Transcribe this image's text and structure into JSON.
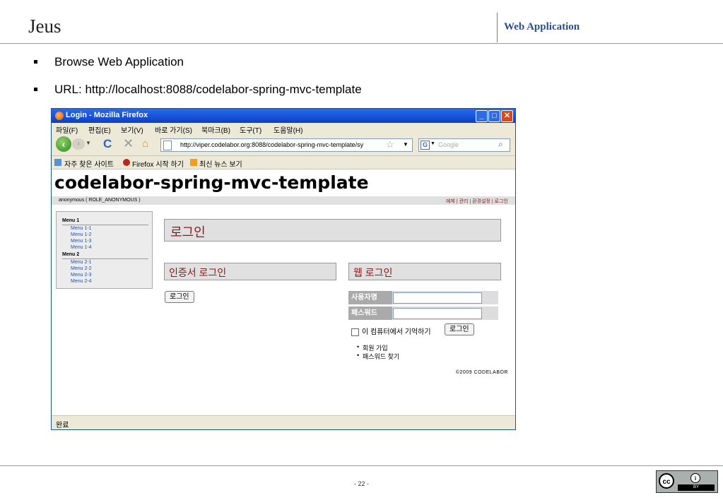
{
  "slide": {
    "title": "Jeus",
    "section": "Web Application",
    "bullets": [
      "Browse Web Application",
      "URL: http://localhost:8088/codelabor-spring-mvc-template"
    ],
    "page_number": "- 22 -"
  },
  "browser": {
    "window_title": "Login - Mozilla Firefox",
    "menu": [
      "파일(F)",
      "편집(E)",
      "보기(V)",
      "바로 가기(S)",
      "북마크(B)",
      "도구(T)",
      "도움말(H)"
    ],
    "url": "http://viper.codelabor.org:8088/codelabor-spring-mvc-template/sy",
    "search_placeholder": "Google",
    "bookmarks": [
      "자주 찾은 사이트",
      "Firefox 시작 하기",
      "최신 뉴스 보기"
    ],
    "status": "완료"
  },
  "site": {
    "title": "codelabor-spring-mvc-template",
    "user": "anonymous ( ROLE_ANONYMOUS )",
    "top_links": "예제 | 관리 | 환경설정 | 로그인",
    "menu": {
      "group1": "Menu 1",
      "group1_items": [
        "Menu 1-1",
        "Menu 1-2",
        "Menu 1-3",
        "Menu 1-4"
      ],
      "group2": "Menu 2",
      "group2_items": [
        "Menu 2-1",
        "Menu 2-2",
        "Menu 2-3",
        "Menu 2-4"
      ]
    },
    "login_heading": "로그인",
    "cert_heading": "인증서 로그인",
    "cert_button": "로그인",
    "web_heading": "웹 로그인",
    "username_label": "사용자명",
    "password_label": "패스워드",
    "username_value": "",
    "password_value": "",
    "remember_label": "이 컴퓨터에서 기억하기",
    "login_button": "로그인",
    "links": [
      "회원 가입",
      "패스워드 찾기"
    ],
    "copyright": "©2009 CODELABOR"
  },
  "license": {
    "cc": "cc",
    "by": "BY"
  }
}
